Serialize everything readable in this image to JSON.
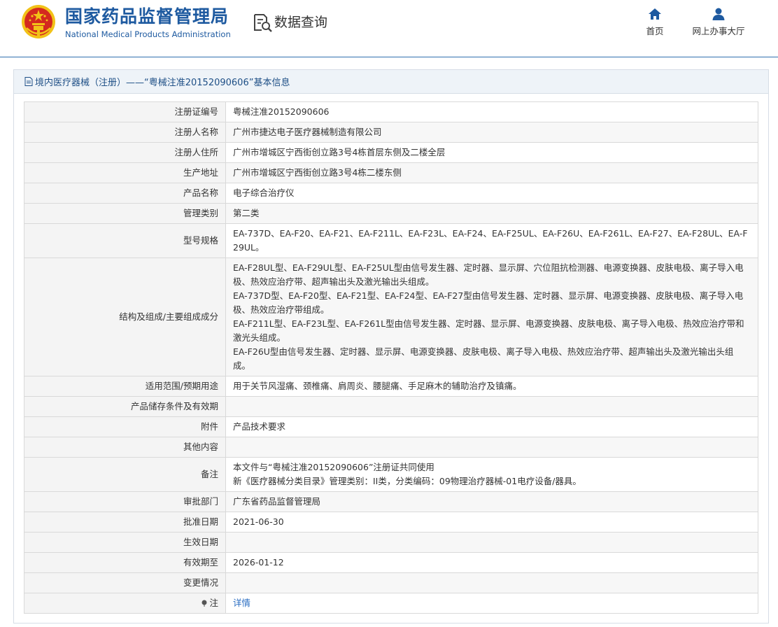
{
  "header": {
    "site_name_cn": "国家药品监督管理局",
    "site_name_en": "National Medical Products Administration",
    "section_label": "数据查询",
    "nav": [
      {
        "label": "首页",
        "icon": "home-icon"
      },
      {
        "label": "网上办事大厅",
        "icon": "user-icon"
      }
    ]
  },
  "panel": {
    "title": "境内医疗器械（注册）——“粤械注准20152090606”基本信息"
  },
  "rows": [
    {
      "label": "注册证编号",
      "value": "粤械注准20152090606"
    },
    {
      "label": "注册人名称",
      "value": "广州市捷达电子医疗器械制造有限公司"
    },
    {
      "label": "注册人住所",
      "value": "广州市增城区宁西街创立路3号4栋首层东侧及二楼全层"
    },
    {
      "label": "生产地址",
      "value": "广州市增城区宁西街创立路3号4栋二楼东侧"
    },
    {
      "label": "产品名称",
      "value": "电子综合治疗仪"
    },
    {
      "label": "管理类别",
      "value": "第二类"
    },
    {
      "label": "型号规格",
      "value": "EA-737D、EA-F20、EA-F21、EA-F211L、EA-F23L、EA-F24、EA-F25UL、EA-F26U、EA-F261L、EA-F27、EA-F28UL、EA-F29UL。"
    },
    {
      "label": "结构及组成/主要组成成分",
      "lines": [
        "EA-F28UL型、EA-F29UL型、EA-F25UL型由信号发生器、定时器、显示屏、穴位阻抗检测器、电源变换器、皮肤电极、离子导入电极、热效应治疗带、超声输出头及激光输出头组成。",
        "EA-737D型、EA-F20型、EA-F21型、EA-F24型、EA-F27型由信号发生器、定时器、显示屏、电源变换器、皮肤电极、离子导入电极、热效应治疗带组成。",
        "EA-F211L型、EA-F23L型、EA-F261L型由信号发生器、定时器、显示屏、电源变换器、皮肤电极、离子导入电极、热效应治疗带和激光头组成。",
        "EA-F26U型由信号发生器、定时器、显示屏、电源变换器、皮肤电极、离子导入电极、热效应治疗带、超声输出头及激光输出头组成。"
      ]
    },
    {
      "label": "适用范围/预期用途",
      "value": "用于关节风湿痛、颈椎痛、肩周炎、腰腿痛、手足麻木的辅助治疗及镇痛。"
    },
    {
      "label": "产品储存条件及有效期",
      "value": ""
    },
    {
      "label": "附件",
      "value": "产品技术要求"
    },
    {
      "label": "其他内容",
      "value": ""
    },
    {
      "label": "备注",
      "lines": [
        "本文件与“粤械注准20152090606”注册证共同使用",
        "新《医疗器械分类目录》管理类别：II类，分类编码：09物理治疗器械-01电疗设备/器具。"
      ]
    },
    {
      "label": "审批部门",
      "value": "广东省药品监督管理局"
    },
    {
      "label": "批准日期",
      "value": "2021-06-30"
    },
    {
      "label": "生效日期",
      "value": ""
    },
    {
      "label": "有效期至",
      "value": "2026-01-12"
    },
    {
      "label": "变更情况",
      "value": ""
    },
    {
      "label": "注",
      "value": "详情",
      "icon": "pin-icon"
    }
  ],
  "colors": {
    "brand_blue": "#1e5aa0",
    "link_blue": "#2a6dc2",
    "emblem_red": "#d42a1f",
    "emblem_gold": "#f2c218"
  }
}
